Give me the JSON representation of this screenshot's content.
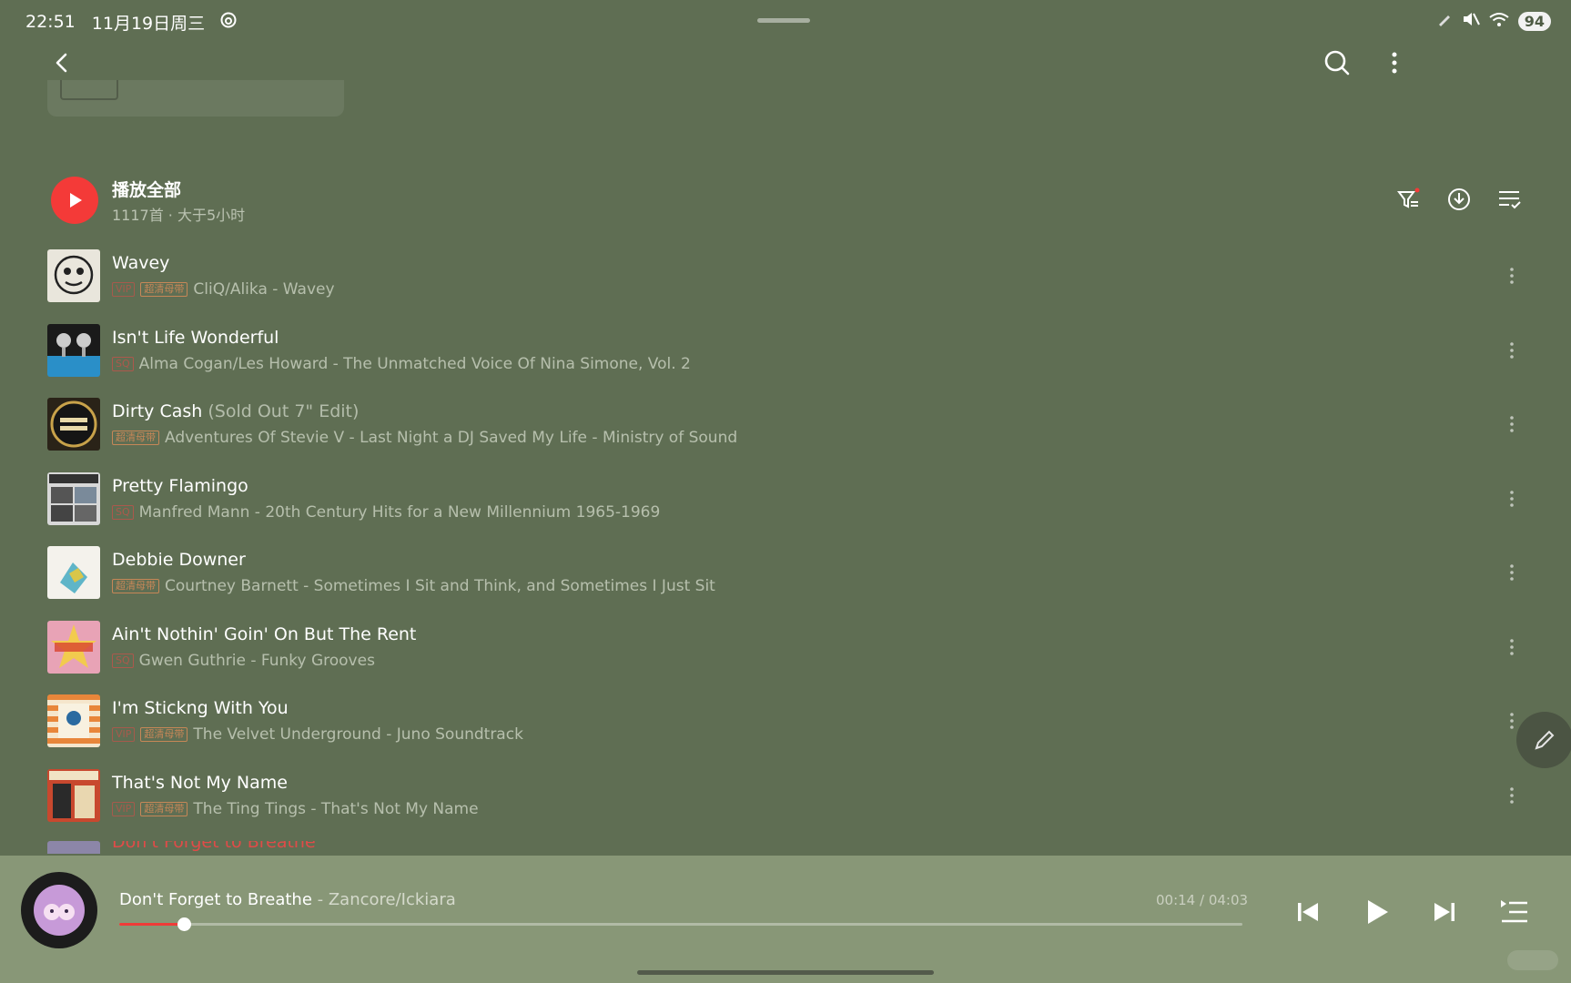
{
  "status_bar": {
    "time": "22:51",
    "date": "11月19日周三",
    "battery": "94"
  },
  "top_bar": {
    "back_icon": "chevron-left-icon",
    "search_icon": "search-icon",
    "more_icon": "more-vertical-icon"
  },
  "play_all": {
    "label": "播放全部",
    "summary": "1117首 · 大于5小时",
    "accent_color": "#f43a38",
    "tools": [
      "filter-icon",
      "download-icon",
      "multi-select-icon"
    ]
  },
  "songs": [
    {
      "title": "Wavey",
      "version": "",
      "badges": [
        "VIP",
        "超清母带"
      ],
      "meta": "CliQ/Alika - Wavey"
    },
    {
      "title": "Isn't Life Wonderful",
      "version": "",
      "badges": [
        "SQ"
      ],
      "meta": "Alma Cogan/Les Howard - The Unmatched Voice Of Nina Simone, Vol. 2"
    },
    {
      "title": "Dirty Cash",
      "version": "(Sold Out 7\" Edit)",
      "badges": [
        "超清母带"
      ],
      "meta": "Adventures Of Stevie V - Last Night a DJ Saved My Life - Ministry of Sound"
    },
    {
      "title": "Pretty Flamingo",
      "version": "",
      "badges": [
        "SQ"
      ],
      "meta": "Manfred Mann - 20th Century Hits for a New Millennium 1965-1969"
    },
    {
      "title": "Debbie Downer",
      "version": "",
      "badges": [
        "超清母带"
      ],
      "meta": "Courtney Barnett - Sometimes I Sit and Think, and Sometimes I Just Sit"
    },
    {
      "title": "Ain't Nothin' Goin' On But The Rent",
      "version": "",
      "badges": [
        "SQ"
      ],
      "meta": "Gwen Guthrie - Funky Grooves"
    },
    {
      "title": "I'm Stickng With You",
      "version": "",
      "badges": [
        "VIP",
        "超清母带"
      ],
      "meta": "The Velvet Underground - Juno Soundtrack"
    },
    {
      "title": "That's Not My Name",
      "version": "",
      "badges": [
        "VIP",
        "超清母带"
      ],
      "meta": "The Ting Tings - That's Not My Name"
    }
  ],
  "partial_next_title": "Don't Forget to Breathe",
  "player": {
    "title": "Don't Forget to Breathe",
    "separator": " - ",
    "artist": "Zancore/Ickiara",
    "time": "00:14 / 04:03",
    "progress_fraction": 0.0576,
    "controls": [
      "previous-icon",
      "play-icon",
      "next-icon",
      "playlist-icon"
    ]
  }
}
